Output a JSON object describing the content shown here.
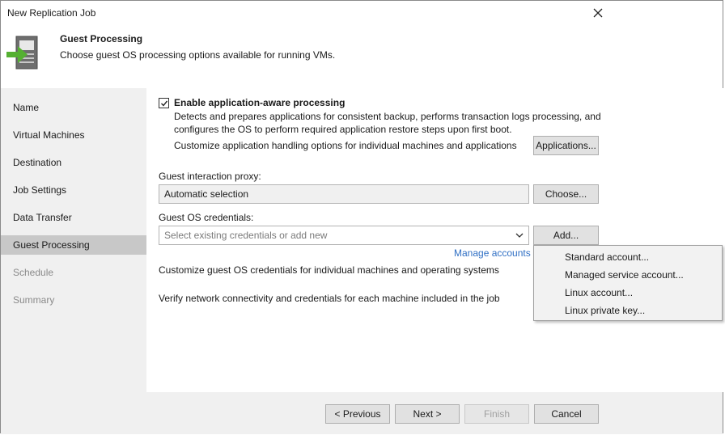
{
  "window": {
    "title": "New Replication Job"
  },
  "header": {
    "title": "Guest Processing",
    "subtitle": "Choose guest OS processing options available for running VMs."
  },
  "sidebar": {
    "steps": [
      {
        "label": "Name",
        "state": "normal"
      },
      {
        "label": "Virtual Machines",
        "state": "normal"
      },
      {
        "label": "Destination",
        "state": "normal"
      },
      {
        "label": "Job Settings",
        "state": "normal"
      },
      {
        "label": "Data Transfer",
        "state": "normal"
      },
      {
        "label": "Guest Processing",
        "state": "active"
      },
      {
        "label": "Schedule",
        "state": "disabled"
      },
      {
        "label": "Summary",
        "state": "disabled"
      }
    ]
  },
  "content": {
    "app_aware": {
      "checked": true,
      "label": "Enable application-aware processing",
      "desc_line1": "Detects and prepares applications for consistent backup, performs transaction logs processing, and",
      "desc_line2": "configures the OS to perform required application restore steps upon first boot.",
      "customize_text": "Customize application handling options for individual machines and applications",
      "applications_button": "Applications..."
    },
    "proxy": {
      "label": "Guest interaction proxy:",
      "value": "Automatic selection",
      "choose_button": "Choose..."
    },
    "credentials": {
      "label": "Guest OS credentials:",
      "placeholder": "Select existing credentials or add new",
      "add_button": "Add...",
      "manage_link": "Manage accounts",
      "customize_text": "Customize guest OS credentials for individual machines and operating systems",
      "verify_text": "Verify network connectivity and credentials for each machine included in the job"
    }
  },
  "dropdown_menu": {
    "items": [
      "Standard account...",
      "Managed service account...",
      "Linux account...",
      "Linux private key..."
    ]
  },
  "footer": {
    "previous": "< Previous",
    "next": "Next >",
    "finish": "Finish",
    "cancel": "Cancel"
  },
  "colors": {
    "accent_green": "#55b032",
    "link_blue": "#2f6fc4",
    "active_step": "#c8c8c8",
    "sidebar_bg": "#f0f0f0"
  }
}
